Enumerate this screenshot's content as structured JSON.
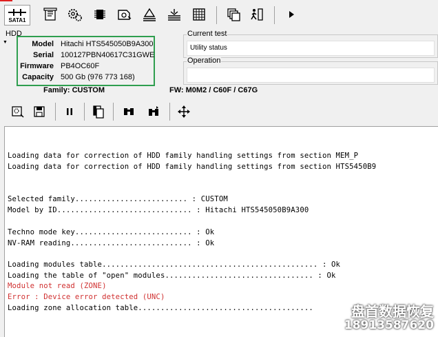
{
  "toolbar": {
    "sata_label": "SATA1"
  },
  "hdd": {
    "group_label": "HDD",
    "rows": [
      {
        "key": "Model",
        "value": "Hitachi HTS545050B9A300"
      },
      {
        "key": "Serial",
        "value": "100127PBN40617C31GWE"
      },
      {
        "key": "Firmware",
        "value": "PB4OC60F"
      },
      {
        "key": "Capacity",
        "value": "500 Gb (976 773 168)"
      }
    ]
  },
  "current_test": {
    "label": "Current test",
    "value": "Utility status"
  },
  "operation": {
    "label": "Operation",
    "value": ""
  },
  "family_line": "Family: CUSTOM",
  "fw_line": "FW: M0M2 / C60F / C67G",
  "console": {
    "lines": [
      {
        "text": "Loading data for correction of HDD family handling settings from section MEM_P",
        "error": false
      },
      {
        "text": "Loading data for correction of HDD family handling settings from section HTS5450B9",
        "error": false
      },
      {
        "text": "Selected family......................... : CUSTOM",
        "error": false
      },
      {
        "text": "Model by ID.............................. : Hitachi HTS545050B9A300",
        "error": false
      },
      {
        "text": "Techno mode key.......................... : Ok",
        "error": false
      },
      {
        "text": "NV-RAM reading........................... : Ok",
        "error": false
      },
      {
        "text": "Loading modules table................................................ : Ok",
        "error": false
      },
      {
        "text": "Loading the table of \"open\" modules................................. : Ok",
        "error": false
      },
      {
        "text": "Module not read (ZONE)",
        "error": true
      },
      {
        "text": "Error : Device error detected (UNC)",
        "error": true
      },
      {
        "text": "Loading zone allocation table.......................................",
        "error": false
      }
    ]
  },
  "watermark": {
    "title": "盘首数据恢复",
    "phone": "18913587620"
  },
  "colors": {
    "highlight_border": "#2e9e4e",
    "error_text": "#d03030"
  }
}
